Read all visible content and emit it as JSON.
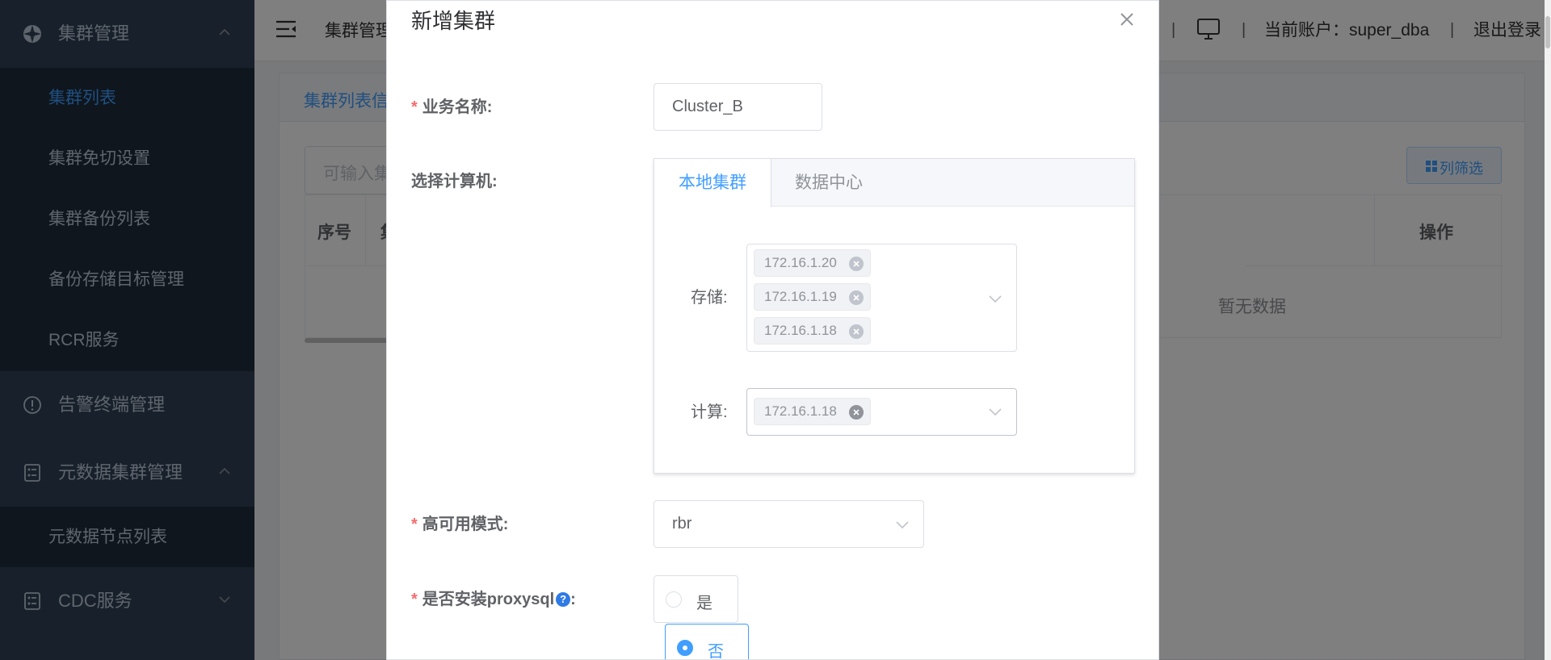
{
  "sidebar": {
    "groups": [
      {
        "label": "集群管理",
        "icon": "cluster-icon",
        "expanded": true
      },
      {
        "label": "告警终端管理",
        "icon": "alert-circle-icon",
        "expanded": false
      },
      {
        "label": "元数据集群管理",
        "icon": "metadata-icon",
        "expanded": true
      },
      {
        "label": "CDC服务",
        "icon": "cdc-icon",
        "expanded": false
      }
    ],
    "cluster_items": [
      "集群列表",
      "集群免切设置",
      "集群备份列表",
      "备份存储目标管理",
      "RCR服务"
    ],
    "metadata_items": [
      "元数据节点列表"
    ],
    "active_item": "集群列表"
  },
  "header": {
    "breadcrumb": "集群管理",
    "separator": "|",
    "account_label": "当前账户：super_dba",
    "logout_label": "退出登录"
  },
  "main": {
    "card_title": "集群列表信",
    "search_placeholder": "可输入集",
    "column_filter_label": "列筛选",
    "table_headers": [
      "序号",
      "集",
      "操作"
    ],
    "empty_text": "暂无数据"
  },
  "dialog": {
    "title": "新增集群",
    "business_name": {
      "label": "业务名称:",
      "value": "Cluster_B",
      "required": true
    },
    "select_machine": {
      "label": "选择计算机:",
      "tabs": [
        "本地集群",
        "数据中心"
      ],
      "active_tab": "本地集群",
      "storage": {
        "label": "存储:",
        "tags": [
          "172.16.1.20",
          "172.16.1.19",
          "172.16.1.18"
        ]
      },
      "compute": {
        "label": "计算:",
        "tags": [
          "172.16.1.18"
        ]
      }
    },
    "ha_mode": {
      "label": "高可用模式:",
      "value": "rbr",
      "required": true
    },
    "install_proxysql": {
      "label": "是否安装proxysql",
      "label_suffix": ":",
      "help_mark": "?",
      "required": true,
      "options": [
        "是",
        "否"
      ],
      "selected": "否"
    }
  },
  "colors": {
    "sidebar_bg": "#304156",
    "submenu_bg": "#1f2d3d",
    "primary": "#409eff",
    "required": "#f56c6c"
  }
}
